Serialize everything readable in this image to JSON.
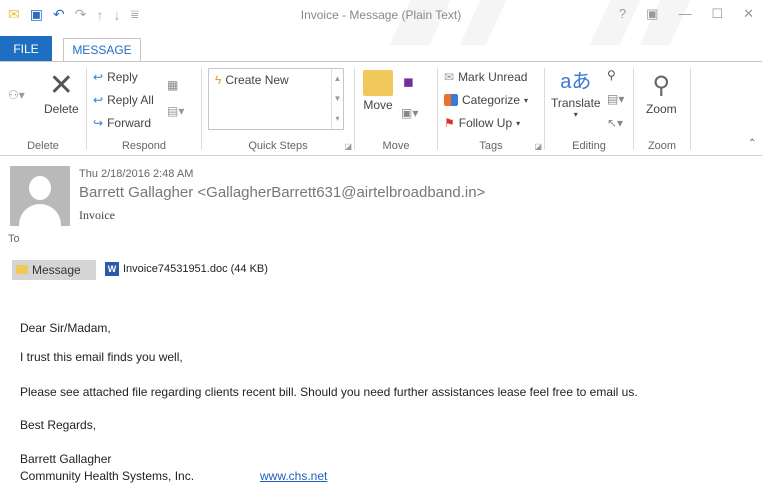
{
  "window": {
    "title": "Invoice - Message (Plain Text)",
    "controls": [
      "?",
      "▣",
      "—",
      "☐",
      "✕"
    ]
  },
  "tabs": {
    "file": "FILE",
    "message": "MESSAGE"
  },
  "ribbon": {
    "delete": {
      "label": "Delete",
      "group": "Delete"
    },
    "respond": {
      "reply": "Reply",
      "reply_all": "Reply All",
      "forward": "Forward",
      "group": "Respond"
    },
    "quick_steps": {
      "create_new": "Create New",
      "group": "Quick Steps"
    },
    "move": {
      "label": "Move",
      "group": "Move"
    },
    "tags": {
      "mark_unread": "Mark Unread",
      "categorize": "Categorize",
      "follow_up": "Follow Up",
      "group": "Tags"
    },
    "editing": {
      "translate": "Translate",
      "group": "Editing"
    },
    "zoom": {
      "label": "Zoom",
      "group": "Zoom"
    }
  },
  "header": {
    "date": "Thu 2/18/2016 2:48 AM",
    "from": "Barrett Gallagher <GallagherBarrett631@airtelbroadband.in>",
    "subject": "Invoice",
    "to_label": "To"
  },
  "attachments": {
    "message_tab": "Message",
    "file": "Invoice74531951.doc (44 KB)"
  },
  "body": {
    "greeting": "Dear Sir/Madam,",
    "line1": "I trust this email finds you well,",
    "line2": "Please see attached file regarding clients recent bill. Should you need further assistances lease feel free to email us.",
    "closing": "Best Regards,",
    "sig_name": "Barrett Gallagher",
    "sig_company": "Community Health Systems, Inc.",
    "sig_link": "www.chs.net"
  },
  "colors": {
    "accent": "#1e6fc1",
    "link": "#1f5fbf"
  }
}
